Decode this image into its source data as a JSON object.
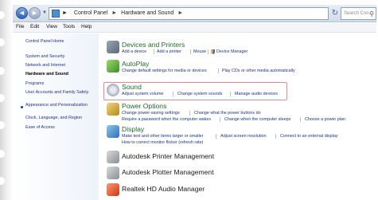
{
  "addressbar": {
    "crumb_root": "Control Panel",
    "crumb_current": "Hardware and Sound",
    "search_placeholder": "Search Con..."
  },
  "menubar": {
    "file": "File",
    "edit": "Edit",
    "view": "View",
    "tools": "Tools",
    "help": "Help"
  },
  "sidebar": {
    "home": "Control Panel Home",
    "items": [
      "System and Security",
      "Network and Internet",
      "Hardware and Sound",
      "Programs",
      "User Accounts and Family Safety",
      "Appearance and Personalization",
      "Clock, Language, and Region",
      "Ease of Access"
    ],
    "current_index": 2
  },
  "categories": {
    "devices": {
      "title": "Devices and Printers",
      "links": [
        "Add a device",
        "Add a printer",
        "Mouse",
        "Device Manager"
      ]
    },
    "autoplay": {
      "title": "AutoPlay",
      "links": [
        "Change default settings for media or devices",
        "Play CDs or other media automatically"
      ]
    },
    "sound": {
      "title": "Sound",
      "links": [
        "Adjust system volume",
        "Change system sounds",
        "Manage audio devices"
      ]
    },
    "power": {
      "title": "Power Options",
      "links": [
        "Change power-saving settings",
        "Change what the power buttons do",
        "Require a password when the computer wakes",
        "Change when the computer sleeps",
        "Choose a power plan"
      ]
    },
    "display": {
      "title": "Display",
      "links": [
        "Make text and other items larger or smaller",
        "Adjust screen resolution",
        "Connect to an external display",
        "How to correct monitor flicker (refresh rate)"
      ]
    },
    "printer_mgmt": {
      "title": "Autodesk Printer Management"
    },
    "plotter_mgmt": {
      "title": "Autodesk Plotter Management"
    },
    "realtek": {
      "title": "Realtek HD Audio Manager"
    }
  },
  "colors": {
    "category_title": "#1d6b2a",
    "link": "#1e3287",
    "highlight": "#e48b8b"
  }
}
